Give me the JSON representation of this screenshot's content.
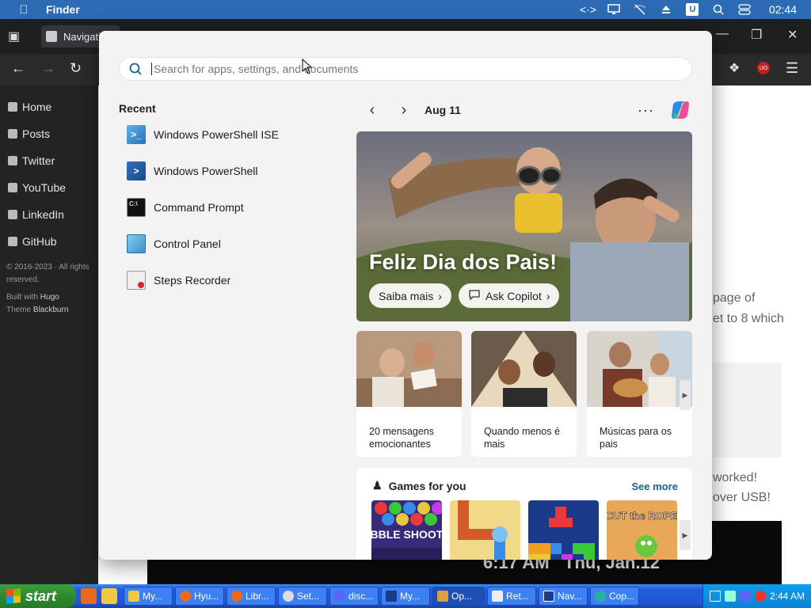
{
  "menubar": {
    "app_name": "Finder",
    "time": "02:44",
    "u_badge": "U"
  },
  "browser": {
    "tab_title": "Navigatio",
    "badge": "UO",
    "site_nav": [
      {
        "label": "Home"
      },
      {
        "label": "Posts"
      },
      {
        "label": "Twitter"
      },
      {
        "label": "YouTube"
      },
      {
        "label": "LinkedIn"
      },
      {
        "label": "GitHub"
      }
    ],
    "footer": {
      "copyright": "© 2016-2023 · All rights reserved.",
      "built_with": "Built with",
      "hugo": "Hugo",
      "theme": "Theme",
      "theme_name": "Blackburn"
    },
    "article_fragments": {
      "line1": "page of",
      "line2": "et to 8 which",
      "line3": "worked!",
      "line4": "over USB!",
      "video_time": "6:17 AM",
      "video_date": "Thu, Jan.12"
    }
  },
  "start": {
    "search": {
      "placeholder": "Search for apps, settings, and documents"
    },
    "recent": {
      "heading": "Recent",
      "items": [
        {
          "label": "Windows PowerShell ISE",
          "icon": "powershell-ise-icon"
        },
        {
          "label": "Windows PowerShell",
          "icon": "powershell-icon"
        },
        {
          "label": "Command Prompt",
          "icon": "command-prompt-icon"
        },
        {
          "label": "Control Panel",
          "icon": "control-panel-icon"
        },
        {
          "label": "Steps Recorder",
          "icon": "steps-recorder-icon"
        }
      ]
    },
    "feed": {
      "date": "Aug 11",
      "more": "···",
      "hero": {
        "title": "Feliz Dia dos Pais!",
        "btn1": "Saiba mais",
        "btn2": "Ask Copilot"
      },
      "cards": [
        {
          "caption": "20 mensagens emocionantes"
        },
        {
          "caption": "Quando menos é mais"
        },
        {
          "caption": "Músicas para os pais"
        }
      ],
      "games": {
        "title": "Games for you",
        "see_more": "See more",
        "tiles": [
          {
            "name": "BUBBLE SHOOTER"
          },
          {
            "name": "pipes"
          },
          {
            "name": "blocks"
          },
          {
            "name": "CUT the ROPE"
          }
        ]
      }
    }
  },
  "taskbar": {
    "start_label": "start",
    "tasks": [
      {
        "label": "My..."
      },
      {
        "label": "Hyu..."
      },
      {
        "label": "Libr..."
      },
      {
        "label": "Set..."
      },
      {
        "label": "disc..."
      },
      {
        "label": "My..."
      },
      {
        "label": "Op..."
      },
      {
        "label": "Ret..."
      },
      {
        "label": "Nav..."
      },
      {
        "label": "Cop..."
      }
    ],
    "clock": "2:44 AM"
  },
  "colors": {
    "accent": "#1a5d8f",
    "xp_blue": "#245edb",
    "xp_green": "#2e8b2e"
  }
}
